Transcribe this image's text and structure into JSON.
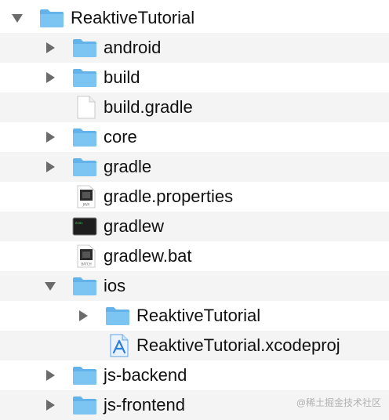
{
  "tree": {
    "root": {
      "label": "ReaktiveTutorial"
    },
    "items": [
      {
        "label": "android"
      },
      {
        "label": "build"
      },
      {
        "label": "build.gradle"
      },
      {
        "label": "core"
      },
      {
        "label": "gradle"
      },
      {
        "label": "gradle.properties",
        "icon_text": "JAVA"
      },
      {
        "label": "gradlew",
        "icon_text": "exec"
      },
      {
        "label": "gradlew.bat",
        "icon_text": "BATCH"
      },
      {
        "label": "ios"
      },
      {
        "label": "ReaktiveTutorial"
      },
      {
        "label": "ReaktiveTutorial.xcodeproj"
      },
      {
        "label": "js-backend"
      },
      {
        "label": "js-frontend"
      }
    ]
  },
  "watermark": {
    "text": "@稀土掘金技术社区"
  },
  "colors": {
    "folder": "#7cc4f2",
    "folder_tab": "#63b3ea",
    "disclosure": "#6b6b6b",
    "alt_row": "#f4f4f5"
  }
}
